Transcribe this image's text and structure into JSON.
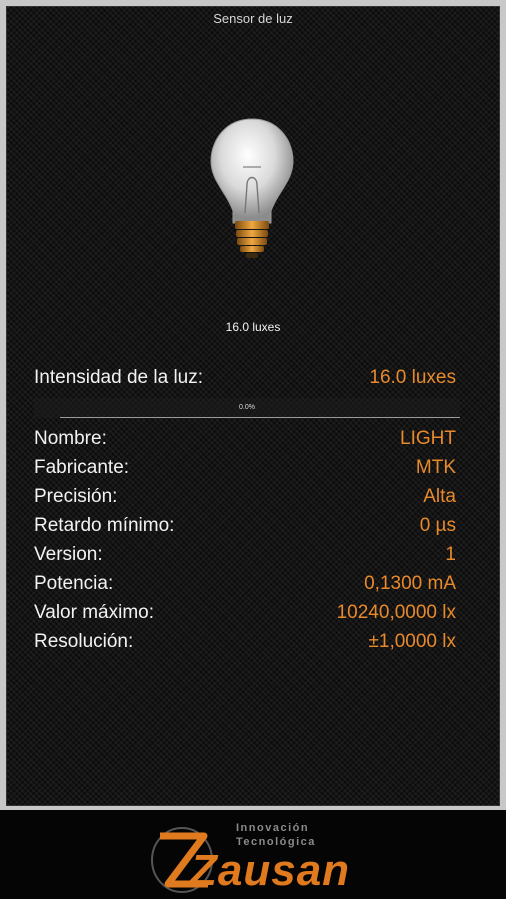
{
  "app": {
    "title": "Sensor de luz"
  },
  "reading": {
    "caption": "16.0 luxes",
    "intensity_label": "Intensidad de la luz:",
    "intensity_value": "16.0 luxes",
    "progress_text": "0.0%",
    "progress_fraction": 0.0
  },
  "details": [
    {
      "key": "Nombre:",
      "value": "LIGHT"
    },
    {
      "key": "Fabricante:",
      "value": "MTK"
    },
    {
      "key": "Precisión:",
      "value": "Alta"
    },
    {
      "key": "Retardo mínimo:",
      "value": "0 µs"
    },
    {
      "key": "Version:",
      "value": "1"
    },
    {
      "key": "Potencia:",
      "value": "0,1300 mA"
    },
    {
      "key": "Valor máximo:",
      "value": "10240,0000 lx"
    },
    {
      "key": "Resolución:",
      "value": "±1,0000 lx"
    }
  ],
  "brand": {
    "line1": "Innovación",
    "line2": "Tecnológica",
    "name": "Zausan"
  },
  "colors": {
    "accent": "#e8892c",
    "label": "#f2f2f2",
    "background": "#141414"
  },
  "icons": {
    "bulb": "light-bulb-icon"
  }
}
